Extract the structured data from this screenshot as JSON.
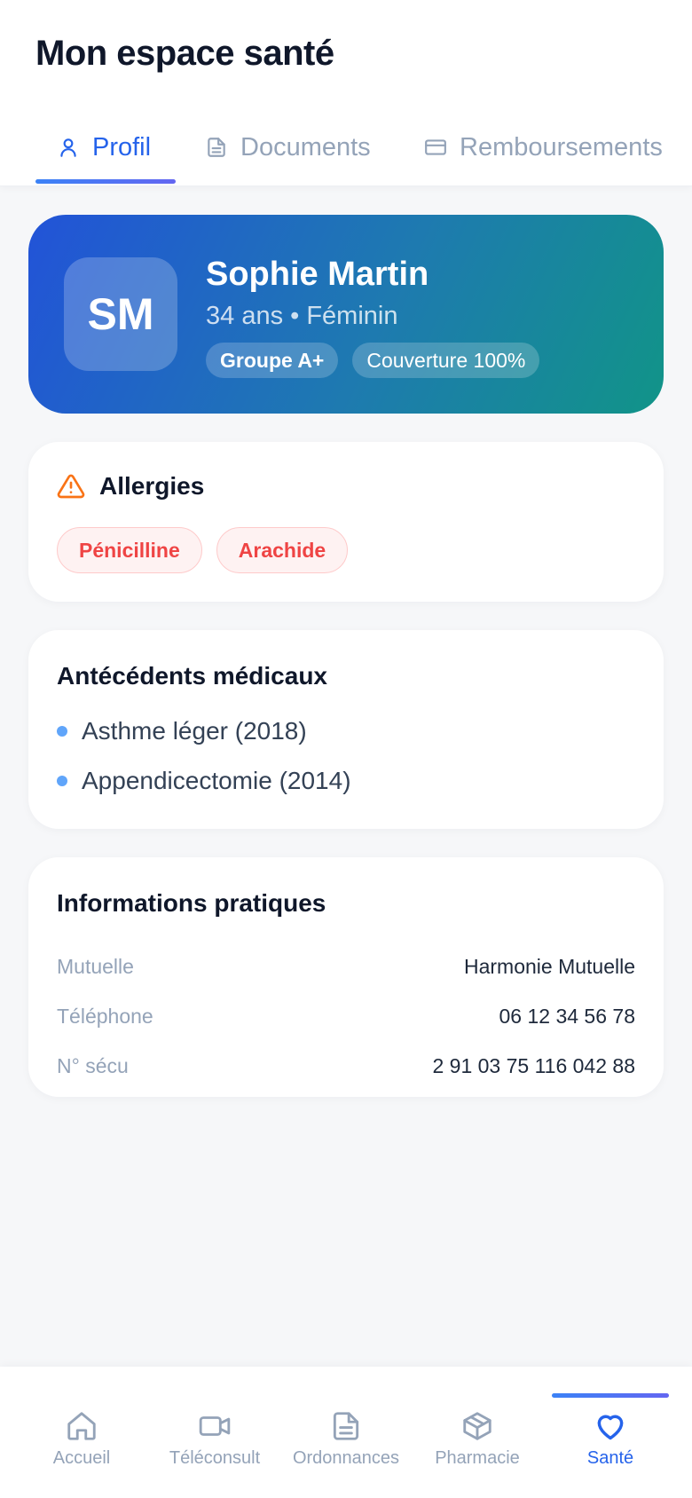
{
  "header": {
    "title": "Mon espace santé"
  },
  "tabs": [
    {
      "label": "Profil",
      "icon": "user-icon",
      "active": true
    },
    {
      "label": "Documents",
      "icon": "document-icon",
      "active": false
    },
    {
      "label": "Remboursements",
      "icon": "card-icon",
      "active": false
    }
  ],
  "profile": {
    "initials": "SM",
    "name": "Sophie Martin",
    "meta": "34 ans • Féminin",
    "badges": [
      "Groupe A+",
      "Couverture 100%"
    ]
  },
  "allergies": {
    "title": "Allergies",
    "icon": "warning-icon",
    "items": [
      "Pénicilline",
      "Arachide"
    ]
  },
  "history": {
    "title": "Antécédents médicaux",
    "items": [
      "Asthme léger (2018)",
      "Appendicectomie (2014)"
    ]
  },
  "info": {
    "title": "Informations pratiques",
    "rows": [
      {
        "label": "Mutuelle",
        "value": "Harmonie Mutuelle"
      },
      {
        "label": "Téléphone",
        "value": "06 12 34 56 78"
      },
      {
        "label": "N° sécu",
        "value": "2 91 03 75 116 042 88"
      }
    ]
  },
  "bottom_nav": [
    {
      "label": "Accueil",
      "icon": "home-icon",
      "active": false
    },
    {
      "label": "Téléconsult",
      "icon": "video-icon",
      "active": false
    },
    {
      "label": "Ordonnances",
      "icon": "prescription-icon",
      "active": false
    },
    {
      "label": "Pharmacie",
      "icon": "box-icon",
      "active": false
    },
    {
      "label": "Santé",
      "icon": "heart-icon",
      "active": true
    }
  ],
  "colors": {
    "accent": "#2563eb",
    "gradient_start": "#2253d8",
    "gradient_end": "#119488",
    "allergy_red": "#ef4444",
    "warning_orange": "#f97316"
  }
}
